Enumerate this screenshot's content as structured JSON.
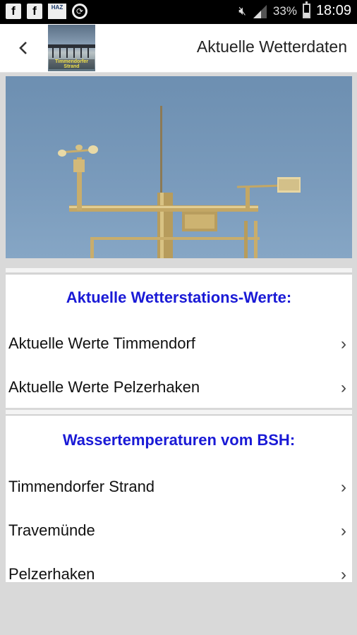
{
  "status_bar": {
    "icons": [
      "facebook-icon",
      "facebook-icon",
      "haz-app-icon",
      "sync-icon"
    ],
    "fb1": "f",
    "fb2": "f",
    "haz_label": "HAZ",
    "battery": "33%",
    "time": "18:09"
  },
  "app_bar": {
    "back_icon": "chevron-left-icon",
    "logo_text": "Timmendorfer Strand",
    "title": "Aktuelle Wetterdaten"
  },
  "hero": {
    "description_icon": "weather-station-photo"
  },
  "sections": [
    {
      "title": "Aktuelle Wetterstations-Werte:",
      "items": [
        {
          "label": "Aktuelle Werte Timmendorf"
        },
        {
          "label": "Aktuelle Werte Pelzerhaken"
        }
      ]
    },
    {
      "title": "Wassertemperaturen vom BSH:",
      "items": [
        {
          "label": "Timmendorfer Strand"
        },
        {
          "label": "Travemünde"
        },
        {
          "label": "Pelzerhaken"
        }
      ]
    }
  ],
  "chevron": "›",
  "colors": {
    "section_title": "#1a1ad6",
    "background": "#d9d9d9",
    "sky": "#7a9bbc"
  }
}
